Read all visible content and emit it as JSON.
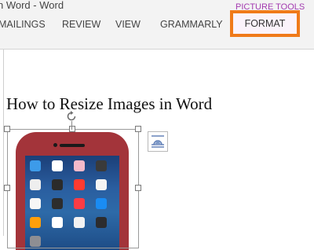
{
  "window": {
    "title": "n Word - Word"
  },
  "ribbon": {
    "context_label": "PICTURE TOOLS",
    "tabs": [
      {
        "label": "MAILINGS"
      },
      {
        "label": "REVIEW"
      },
      {
        "label": "VIEW"
      },
      {
        "label": "GRAMMARLY"
      },
      {
        "label": "FORMAT",
        "highlighted": true,
        "highlight_color": "#f07a1a"
      }
    ]
  },
  "document": {
    "heading": "How to Resize Images in Word"
  },
  "picture": {
    "description_icon": "iphone-image",
    "selected": true
  },
  "icons": {
    "rotate": "rotate-handle-icon",
    "layout": "layout-options-icon"
  },
  "colors": {
    "phone_case": "#a3343a",
    "context_label": "#a33bb0"
  }
}
